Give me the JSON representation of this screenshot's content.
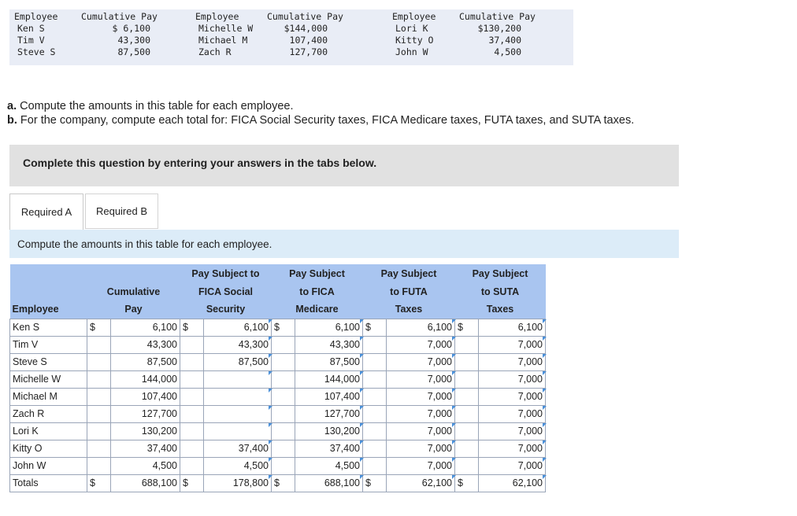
{
  "reference": {
    "blocks": [
      {
        "header": [
          "Employee",
          "Cumulative Pay"
        ],
        "rows": [
          [
            "Ken S",
            "$ 6,100"
          ],
          [
            "Tim V",
            "43,300"
          ],
          [
            "Steve S",
            "87,500"
          ]
        ]
      },
      {
        "header": [
          "Employee",
          "Cumulative Pay"
        ],
        "rows": [
          [
            "Michelle W",
            "$144,000"
          ],
          [
            "Michael M",
            "107,400"
          ],
          [
            "Zach R",
            "127,700"
          ]
        ]
      },
      {
        "header": [
          "Employee",
          "Cumulative Pay"
        ],
        "rows": [
          [
            "Lori K",
            "$130,200"
          ],
          [
            "Kitty O",
            "37,400"
          ],
          [
            "John W",
            "4,500"
          ]
        ]
      }
    ]
  },
  "question": {
    "a_label": "a.",
    "a_text": " Compute the amounts in this table for each employee.",
    "b_label": "b.",
    "b_text": " For the company, compute each total for: FICA Social Security taxes, FICA Medicare taxes, FUTA taxes, and SUTA taxes."
  },
  "banner": "Complete this question by entering your answers in the tabs below.",
  "tabs": [
    "Required A",
    "Required B"
  ],
  "instruction": "Compute the amounts in this table for each employee.",
  "table": {
    "headers": {
      "employee": "Employee",
      "cum": [
        "",
        "Cumulative",
        "Pay"
      ],
      "ss": [
        "Pay Subject to",
        "FICA Social",
        "Security"
      ],
      "med": [
        "Pay Subject",
        "to FICA",
        "Medicare"
      ],
      "futa": [
        "Pay Subject",
        "to FUTA",
        "Taxes"
      ],
      "suta": [
        "Pay Subject",
        "to SUTA",
        "Taxes"
      ]
    },
    "dollar": "$",
    "rows": [
      {
        "name": "Ken S",
        "cum": "6,100",
        "ss": "6,100",
        "med": "6,100",
        "futa": "6,100",
        "suta": "6,100"
      },
      {
        "name": "Tim V",
        "cum": "43,300",
        "ss": "43,300",
        "med": "43,300",
        "futa": "7,000",
        "suta": "7,000"
      },
      {
        "name": "Steve S",
        "cum": "87,500",
        "ss": "87,500",
        "med": "87,500",
        "futa": "7,000",
        "suta": "7,000"
      },
      {
        "name": "Michelle W",
        "cum": "144,000",
        "ss": "",
        "med": "144,000",
        "futa": "7,000",
        "suta": "7,000"
      },
      {
        "name": "Michael M",
        "cum": "107,400",
        "ss": "",
        "med": "107,400",
        "futa": "7,000",
        "suta": "7,000"
      },
      {
        "name": "Zach R",
        "cum": "127,700",
        "ss": "",
        "med": "127,700",
        "futa": "7,000",
        "suta": "7,000"
      },
      {
        "name": "Lori K",
        "cum": "130,200",
        "ss": "",
        "med": "130,200",
        "futa": "7,000",
        "suta": "7,000"
      },
      {
        "name": "Kitty O",
        "cum": "37,400",
        "ss": "37,400",
        "med": "37,400",
        "futa": "7,000",
        "suta": "7,000"
      },
      {
        "name": "John W",
        "cum": "4,500",
        "ss": "4,500",
        "med": "4,500",
        "futa": "7,000",
        "suta": "7,000"
      }
    ],
    "totals": {
      "name": "Totals",
      "cum": "688,100",
      "ss": "178,800",
      "med": "688,100",
      "futa": "62,100",
      "suta": "62,100"
    }
  }
}
